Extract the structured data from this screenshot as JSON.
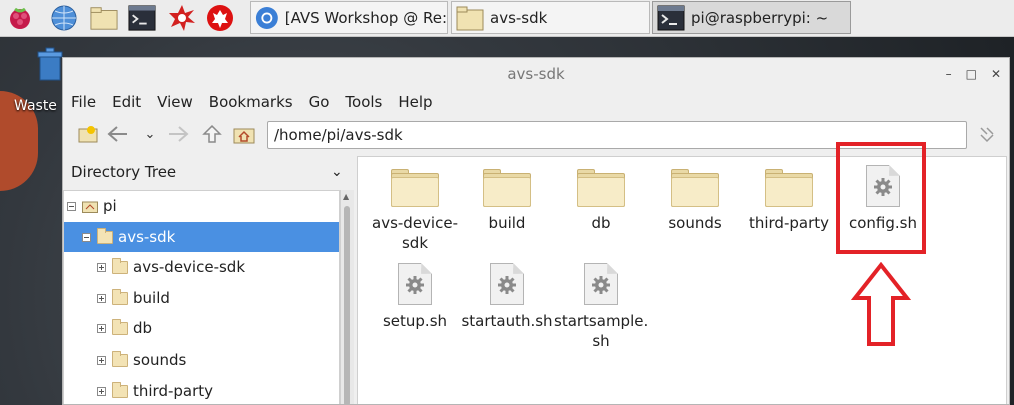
{
  "taskbar": {
    "tasks": [
      {
        "label": "[AVS Workshop @ Re:"
      },
      {
        "label": "avs-sdk"
      },
      {
        "label": "pi@raspberrypi: ~"
      }
    ]
  },
  "desktop": {
    "wastebasket_label": "Waste"
  },
  "window": {
    "title": "avs-sdk",
    "menu": [
      "File",
      "Edit",
      "View",
      "Bookmarks",
      "Go",
      "Tools",
      "Help"
    ],
    "path": "/home/pi/avs-sdk"
  },
  "sidepane": {
    "header": "Directory Tree",
    "tree": [
      {
        "label": "pi"
      },
      {
        "label": "avs-sdk"
      },
      {
        "label": "avs-device-sdk"
      },
      {
        "label": "build"
      },
      {
        "label": "db"
      },
      {
        "label": "sounds"
      },
      {
        "label": "third-party"
      }
    ]
  },
  "files": [
    {
      "name": "avs-device-\nsdk",
      "type": "folder-icon"
    },
    {
      "name": "build",
      "type": "folder-icon"
    },
    {
      "name": "db",
      "type": "folder-icon"
    },
    {
      "name": "sounds",
      "type": "folder-icon"
    },
    {
      "name": "third-party",
      "type": "folder-icon"
    },
    {
      "name": "config.sh",
      "type": "script-icon"
    },
    {
      "name": "setup.sh",
      "type": "script-icon"
    },
    {
      "name": "startauth.sh",
      "type": "script-icon"
    },
    {
      "name": "startsample.\nsh",
      "type": "script-icon"
    }
  ],
  "colors": {
    "selection": "#4a90e2",
    "highlight": "#e32227"
  }
}
